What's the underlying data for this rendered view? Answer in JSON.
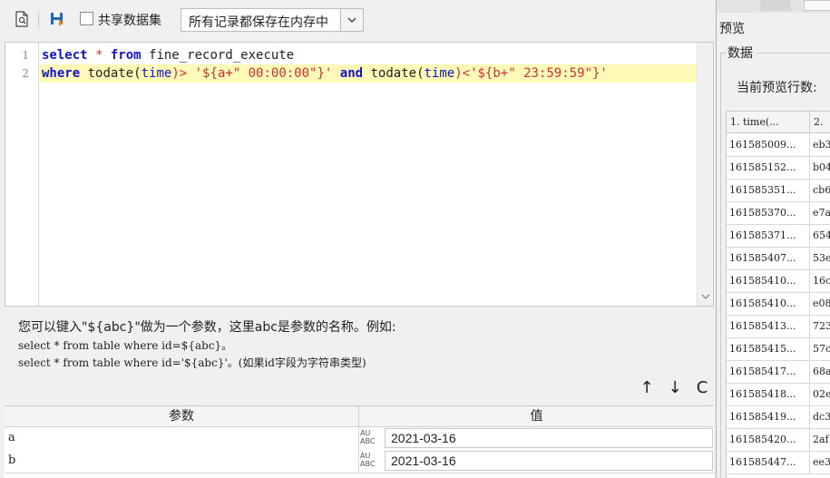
{
  "toolbar": {
    "share_label": "共享数据集",
    "store_option": "所有记录都保存在内存中"
  },
  "editor": {
    "line_numbers": [
      "1",
      "2"
    ],
    "line1": {
      "t1": "select",
      "t2": " * ",
      "t3": "from",
      "t4": " fine_record_execute"
    },
    "line2": {
      "t1": "where",
      "t2": " todate(",
      "t3": "time",
      "t4": ")> ",
      "t5": "'${a+\" 00:00:00\"}'",
      "t6": " ",
      "t7": "and",
      "t8": " todate(",
      "t9": "time",
      "t10": ")<",
      "t11": "'${b+\" 23:59:59\"}'"
    }
  },
  "hint": {
    "line1": "您可以键入\"${abc}\"做为一个参数，这里abc是参数的名称。例如:",
    "line2": "select * from table where id=${abc}。",
    "line3": "select * from table where id='${abc}'。(如果id字段为字符串类型)"
  },
  "actions": {
    "up": "↑",
    "down": "↓",
    "refresh": "C"
  },
  "params": {
    "header_name": "参数",
    "header_value": "值",
    "type_label_top": "AU",
    "type_label_bottom": "ABC",
    "rows": [
      {
        "name": "a",
        "value": "2021-03-16"
      },
      {
        "name": "b",
        "value": "2021-03-16"
      }
    ]
  },
  "preview": {
    "title": "预览",
    "data_label": "数据",
    "rows_label": "当前预览行数:",
    "columns": [
      "1. time(...",
      "2."
    ],
    "rows": [
      [
        "161585009...",
        "eb3"
      ],
      [
        "161585152...",
        "b04"
      ],
      [
        "161585351...",
        "cb6"
      ],
      [
        "161585370...",
        "e7a"
      ],
      [
        "161585371...",
        "654"
      ],
      [
        "161585407...",
        "53e"
      ],
      [
        "161585410...",
        "16c"
      ],
      [
        "161585410...",
        "e08"
      ],
      [
        "161585413...",
        "723"
      ],
      [
        "161585415...",
        "57c"
      ],
      [
        "161585417...",
        "68a"
      ],
      [
        "161585418...",
        "02e"
      ],
      [
        "161585419...",
        "dc3"
      ],
      [
        "161585420...",
        "2af"
      ],
      [
        "161585447...",
        "ee3"
      ]
    ]
  }
}
